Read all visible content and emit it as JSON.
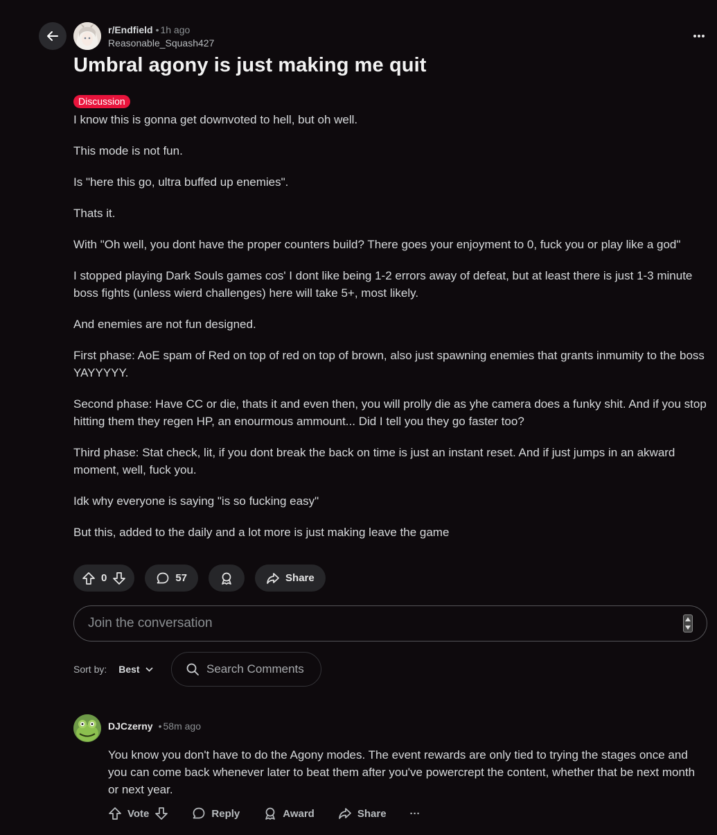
{
  "post": {
    "subreddit": "r/Endfield",
    "time": "1h ago",
    "author": "Reasonable_Squash427",
    "title": "Umbral agony is just making me quit",
    "flair": "Discussion",
    "flair_color": "#e8143c",
    "paragraphs": [
      "I know this is gonna get downvoted to hell, but oh well.",
      "This mode is not fun.",
      "Is \"here this go, ultra buffed up enemies\".",
      "Thats it.",
      "With \"Oh well, you dont have the proper counters build? There goes your enjoyment to 0, fuck you or play like a god\"",
      "I stopped playing Dark Souls games cos' I dont like being 1-2 errors away of defeat, but at least there is just 1-3 minute boss fights (unless wierd challenges) here will take 5+, most likely.",
      "And enemies are not fun designed.",
      "First phase: AoE spam of Red on top of red on top of brown, also just spawning enemies that grants inmumity to the boss YAYYYYY.",
      "Second phase: Have CC or die, thats it and even then, you will prolly die as yhe camera does a funky shit. And if you stop hitting them they regen HP, an enourmous ammount... Did I tell you they go faster too?",
      "Third phase: Stat check, lit, if you dont break the back on time is just an instant reset. And if just jumps in an akward moment, well, fuck you.",
      "Idk why everyone is saying \"is so fucking easy\"",
      "But this, added to the daily and a lot more is just making leave the game"
    ],
    "score": "0",
    "comment_count": "57",
    "share_label": "Share"
  },
  "composer": {
    "placeholder": "Join the conversation"
  },
  "sort": {
    "label": "Sort by:",
    "value": "Best"
  },
  "search_comments": {
    "placeholder": "Search Comments"
  },
  "comment": {
    "author": "DJCzerny",
    "time": "58m ago",
    "text": "You know you don't have to do the Agony modes. The event rewards are only tied to trying the stages once and you can come back whenever later to beat them after you've powercrept the content, whether that be next month or next year.",
    "vote_label": "Vote",
    "reply_label": "Reply",
    "award_label": "Award",
    "share_label": "Share",
    "more_label": "···"
  }
}
